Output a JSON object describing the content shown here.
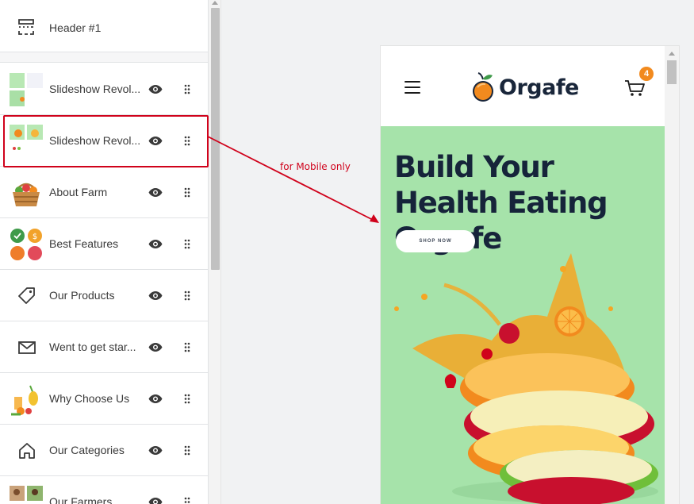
{
  "sidebar": {
    "header": {
      "label": "Header #1"
    },
    "sections": [
      {
        "label": "Slideshow Revol...",
        "thumb": "slideshow-thumb-1"
      },
      {
        "label": "Slideshow Revol...",
        "thumb": "slideshow-thumb-2"
      },
      {
        "label": "About Farm",
        "thumb": "basket-thumb"
      },
      {
        "label": "Best Features",
        "thumb": "features-thumb"
      },
      {
        "label": "Our Products",
        "icon": "tag-icon"
      },
      {
        "label": "Went to get star...",
        "icon": "mail-icon"
      },
      {
        "label": "Why Choose Us",
        "thumb": "fruits-thumb"
      },
      {
        "label": "Our Categories",
        "icon": "home-icon"
      },
      {
        "label": "Our Farmers",
        "thumb": "farmers-thumb"
      }
    ]
  },
  "annotation": {
    "text": "for Mobile only",
    "color": "#d0021b"
  },
  "preview": {
    "logo_text": "Orgafe",
    "cart_count": "4",
    "hero_title": "Build Your Health Eating Orgafe",
    "shop_button": "SHOP NOW",
    "hero_bg": "#a6e3aa",
    "accent": "#f28a1e"
  }
}
